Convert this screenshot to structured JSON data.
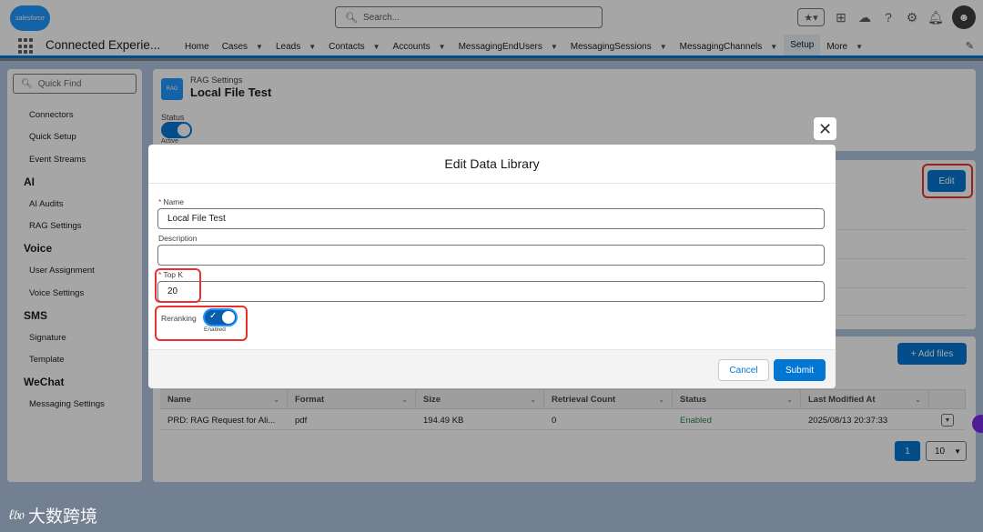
{
  "header": {
    "logo_text": "salesforce",
    "search_placeholder": "Search...",
    "icons": [
      "favorites-star-icon",
      "add-icon",
      "trailhead-icon",
      "help-icon",
      "settings-gear-icon",
      "notifications-bell-icon",
      "user-avatar-icon"
    ]
  },
  "nav": {
    "app_name": "Connected Experie...",
    "items": [
      {
        "label": "Home",
        "chevron": false
      },
      {
        "label": "Cases",
        "chevron": true
      },
      {
        "label": "Leads",
        "chevron": true
      },
      {
        "label": "Contacts",
        "chevron": true
      },
      {
        "label": "Accounts",
        "chevron": true
      },
      {
        "label": "MessagingEndUsers",
        "chevron": true
      },
      {
        "label": "MessagingSessions",
        "chevron": true
      },
      {
        "label": "MessagingChannels",
        "chevron": true
      },
      {
        "label": "Setup",
        "chevron": false,
        "active": true
      },
      {
        "label": "More",
        "chevron": true
      }
    ]
  },
  "sidebar": {
    "quick_find_placeholder": "Quick Find",
    "entries": [
      {
        "type": "item",
        "label": "Connectors"
      },
      {
        "type": "item",
        "label": "Quick Setup"
      },
      {
        "type": "item",
        "label": "Event Streams"
      },
      {
        "type": "head",
        "label": "AI"
      },
      {
        "type": "item",
        "label": "AI Audits"
      },
      {
        "type": "item",
        "label": "RAG Settings"
      },
      {
        "type": "head",
        "label": "Voice"
      },
      {
        "type": "item",
        "label": "User Assignment"
      },
      {
        "type": "item",
        "label": "Voice Settings"
      },
      {
        "type": "head",
        "label": "SMS"
      },
      {
        "type": "item",
        "label": "Signature"
      },
      {
        "type": "item",
        "label": "Template"
      },
      {
        "type": "head",
        "label": "WeChat"
      },
      {
        "type": "item",
        "label": "Messaging Settings"
      }
    ]
  },
  "page": {
    "icon_text": "RAG",
    "breadcrumb": "RAG Settings",
    "title": "Local File Test",
    "status_label": "Status",
    "status_value": "Active",
    "edit_label": "Edit",
    "add_files_label": "+ Add files"
  },
  "table": {
    "columns": [
      "Name",
      "Format",
      "Size",
      "Retrieval Count",
      "Status",
      "Last Modified At"
    ],
    "rows": [
      {
        "name": "PRD: RAG Request for Ali...",
        "format": "pdf",
        "size": "194.49 KB",
        "retrieval_count": "0",
        "status": "Enabled",
        "last_modified": "2025/08/13 20:37:33"
      }
    ],
    "current_page": "1",
    "page_size": "10"
  },
  "modal": {
    "title": "Edit Data Library",
    "close_glyph": "✕",
    "name_label": "Name",
    "name_value": "Local File Test",
    "description_label": "Description",
    "description_value": "",
    "topk_label": "Top K",
    "topk_value": "20",
    "reranking_label": "Reranking",
    "reranking_state": "Enabled",
    "cancel_label": "Cancel",
    "submit_label": "Submit"
  },
  "watermark": {
    "mark": "ℓ𝔟𝔬",
    "text": "大数跨境"
  },
  "colors": {
    "brand_blue": "#0176d3",
    "highlight_red": "#e8312f",
    "enabled_green": "#2e844a",
    "backdrop": "#b0c4df"
  }
}
